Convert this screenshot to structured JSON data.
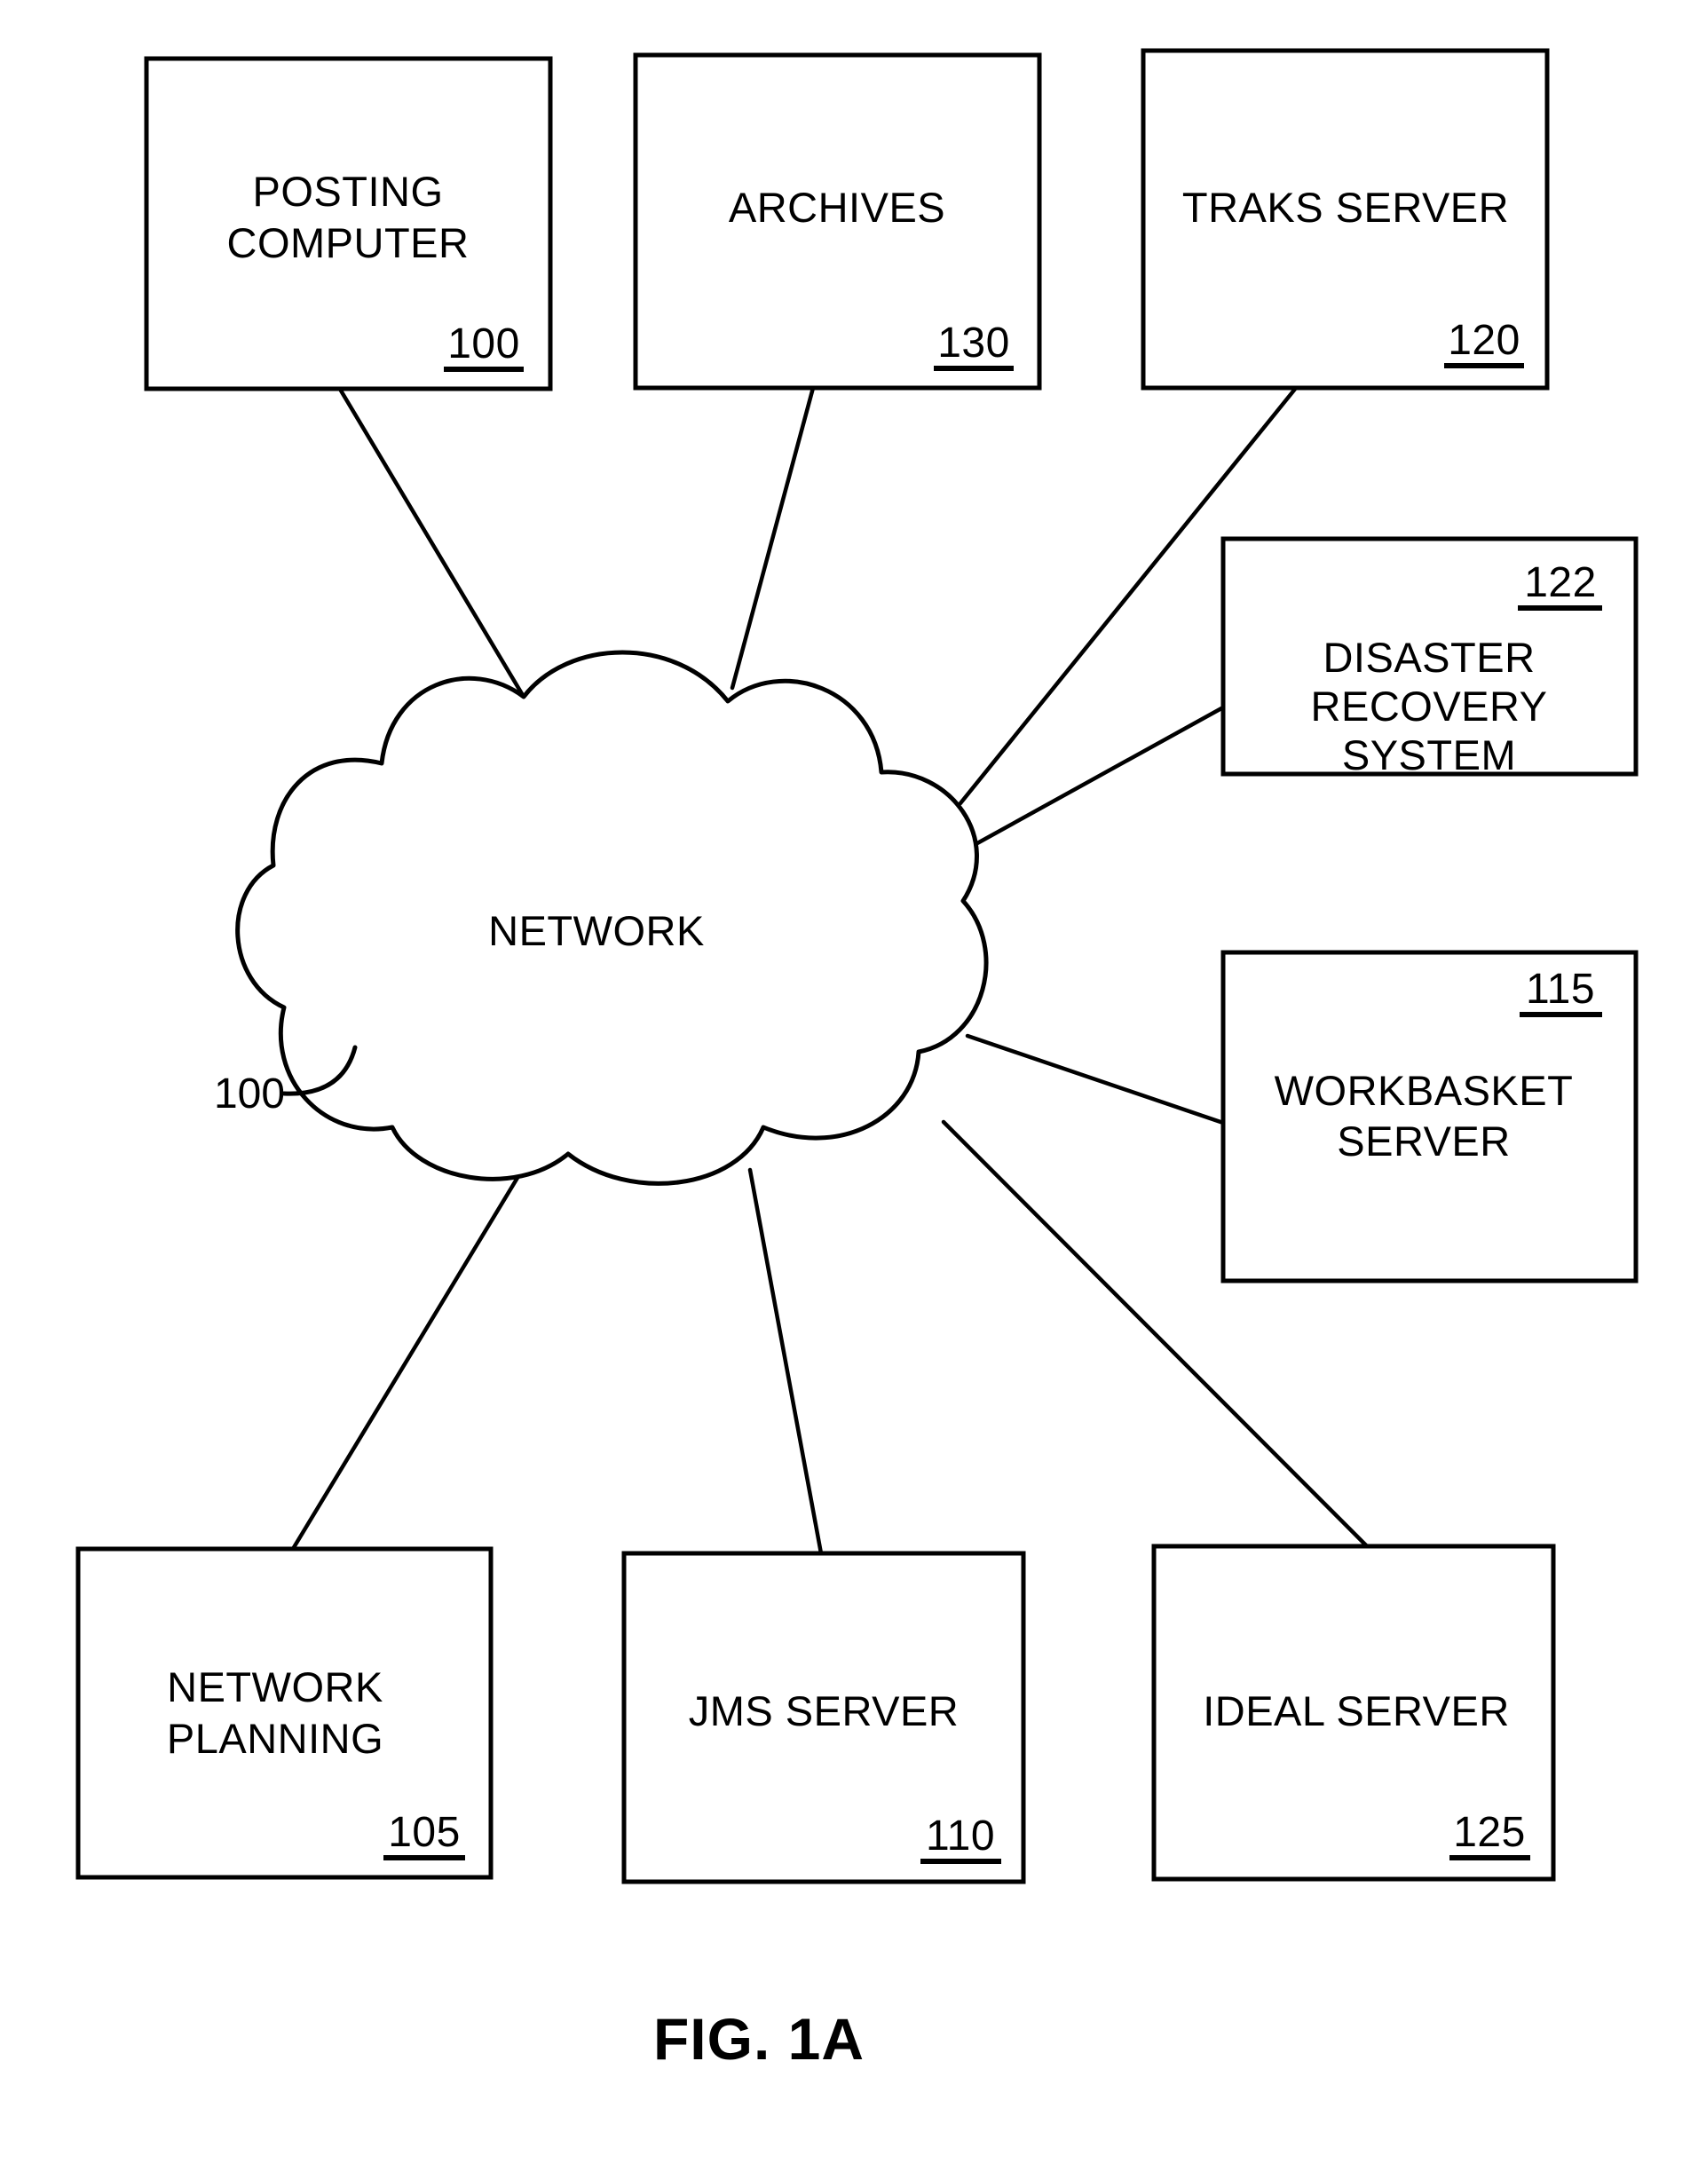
{
  "figure": {
    "caption": "FIG. 1A",
    "type": "network-architecture-block-diagram"
  },
  "cloud": {
    "label": "NETWORK",
    "reference": "100"
  },
  "nodes": [
    {
      "id": "posting-computer",
      "line1": "POSTING",
      "line2": "COMPUTER",
      "reference": "100"
    },
    {
      "id": "archives",
      "line1": "ARCHIVES",
      "line2": "",
      "reference": "130"
    },
    {
      "id": "traks-server",
      "line1": "TRAKS SERVER",
      "line2": "",
      "reference": "120"
    },
    {
      "id": "disaster-recovery-system",
      "line1": "DISASTER",
      "line2": "RECOVERY",
      "line3": "SYSTEM",
      "reference": "122"
    },
    {
      "id": "workbasket-server",
      "line1": "WORKBASKET",
      "line2": "SERVER",
      "reference": "115"
    },
    {
      "id": "network-planning",
      "line1": "NETWORK",
      "line2": "PLANNING",
      "reference": "105"
    },
    {
      "id": "jms-server",
      "line1": "JMS SERVER",
      "line2": "",
      "reference": "110"
    },
    {
      "id": "ideal-server",
      "line1": "IDEAL SERVER",
      "line2": "",
      "reference": "125"
    }
  ],
  "colors": {
    "ink": "#000000",
    "paper": "#ffffff"
  }
}
